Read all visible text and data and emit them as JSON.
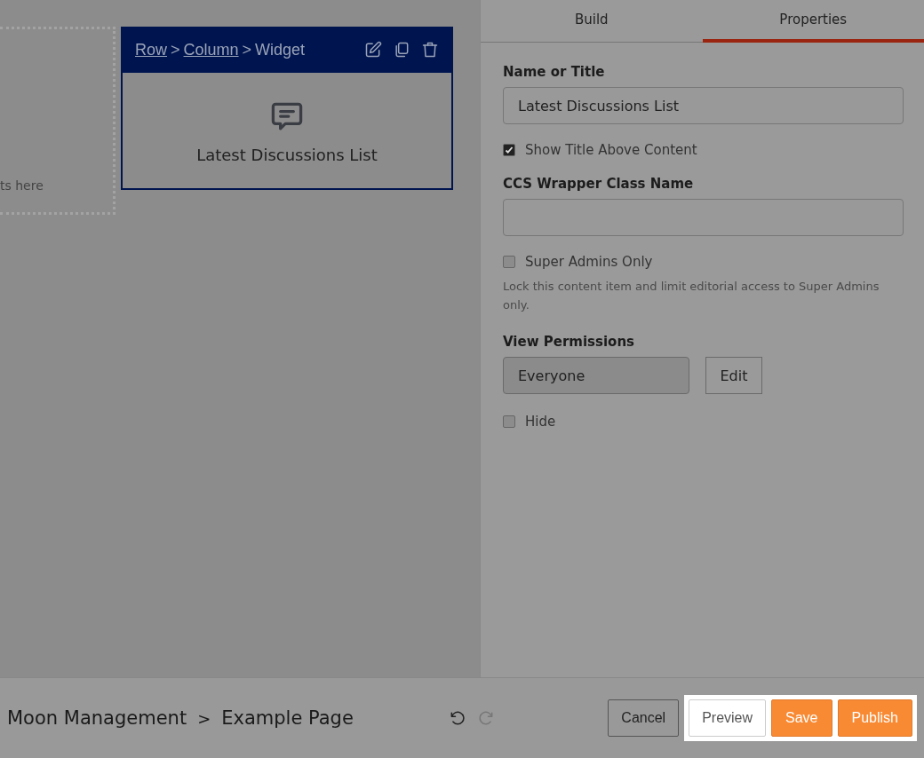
{
  "canvas": {
    "drop_zone": {
      "text": "ts here"
    },
    "widget": {
      "breadcrumb": [
        {
          "label": "Row",
          "link": true
        },
        {
          "label": "Column",
          "link": true
        },
        {
          "label": "Widget",
          "link": false
        }
      ],
      "separator": ">",
      "title": "Latest Discussions List"
    }
  },
  "panel": {
    "tabs": [
      {
        "label": "Build",
        "selected": false
      },
      {
        "label": "Properties",
        "selected": true
      }
    ],
    "fields": [
      {
        "kind": "text",
        "label": "Name or Title",
        "value": "Latest Discussions List"
      },
      {
        "kind": "checkbox",
        "label": "Show Title Above Content",
        "checked": true
      },
      {
        "kind": "text",
        "label": "CCS Wrapper Class Name"
      },
      {
        "kind": "checkbox",
        "label": "Super Admins Only",
        "checked": false,
        "help": "Lock this content item and limit editorial access to Super Admins only."
      },
      {
        "kind": "permissions",
        "label": "View Permissions",
        "value": "Everyone",
        "button": "Edit"
      },
      {
        "kind": "checkbox",
        "label": "Hide",
        "checked": false
      }
    ]
  },
  "footer": {
    "breadcrumb": [
      "Moon Management",
      "Example Page"
    ],
    "separator": ">",
    "undo": {
      "disabled": false
    },
    "redo": {
      "disabled": true
    },
    "buttons": [
      {
        "label": "Cancel",
        "kind": "dimmed"
      },
      {
        "label": "Preview",
        "kind": "plain"
      },
      {
        "label": "Save",
        "kind": "primary"
      },
      {
        "label": "Publish",
        "kind": "primary"
      }
    ]
  }
}
